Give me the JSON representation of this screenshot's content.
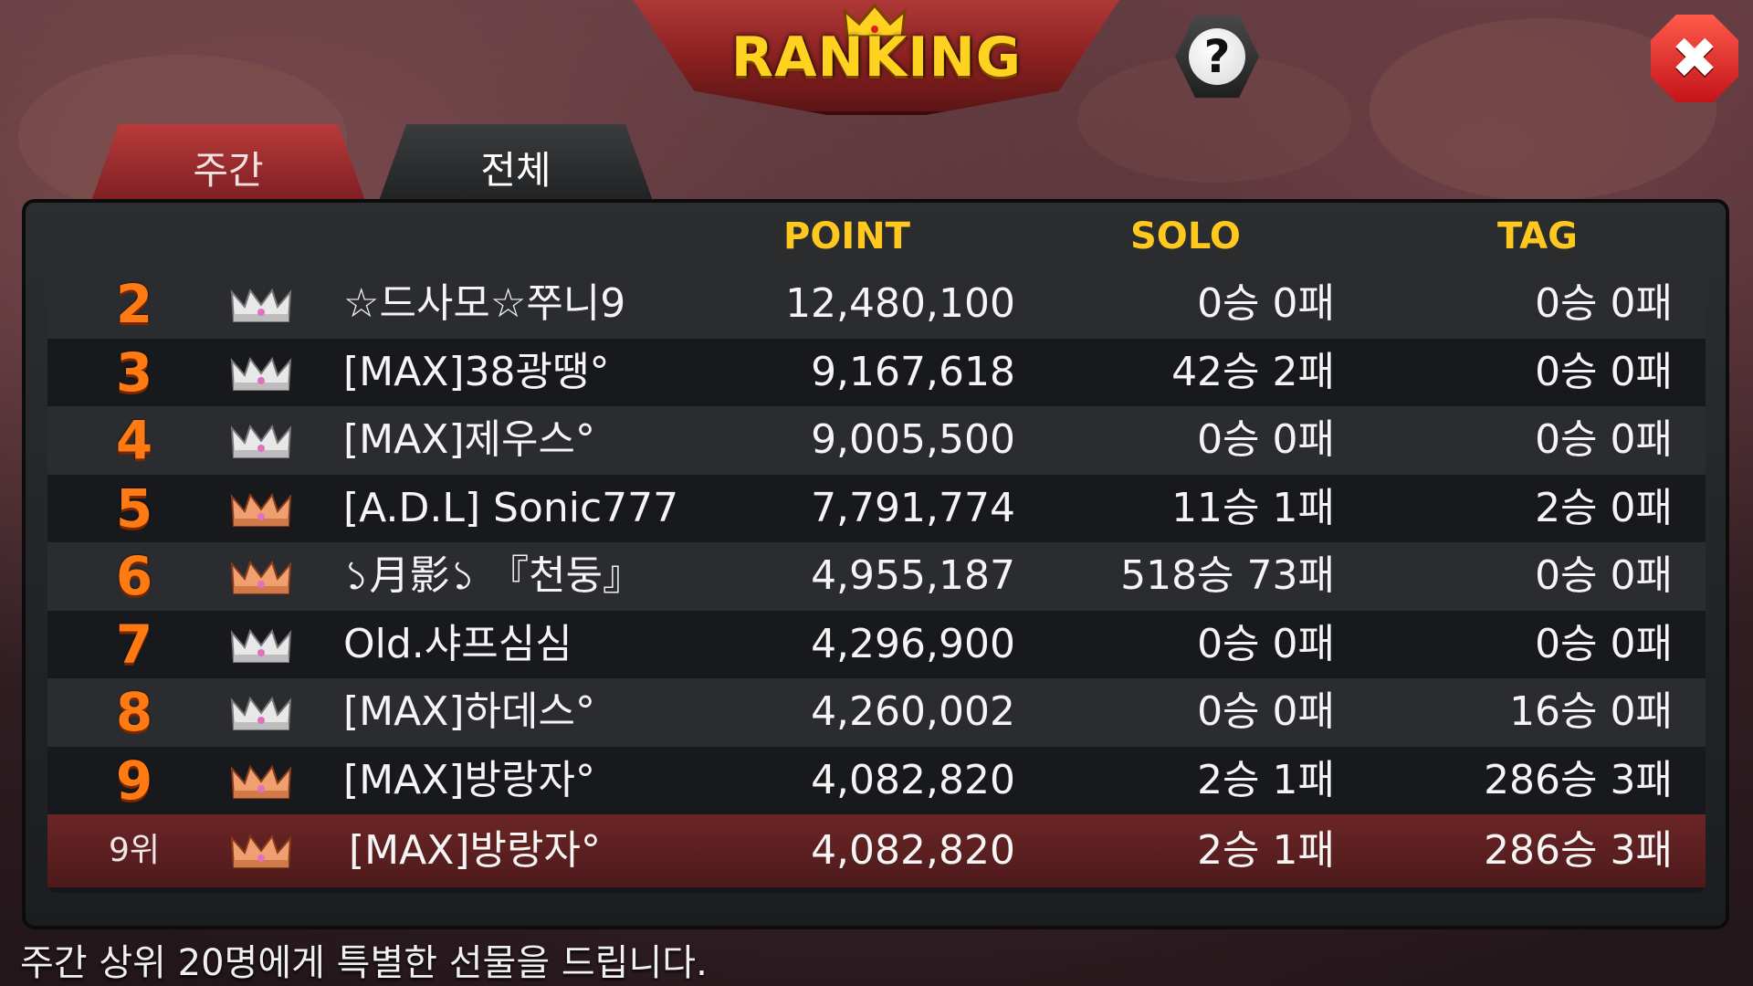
{
  "header": {
    "title": "RANKING",
    "help_label": "?",
    "close_label": "✖"
  },
  "tabs": [
    {
      "label": "주간"
    },
    {
      "label": "전체"
    }
  ],
  "columns": {
    "point": "POINT",
    "solo": "SOLO",
    "tag": "TAG"
  },
  "colors": {
    "crown_silver": "#e8e8e8",
    "crown_bronze": "#f0a070",
    "rank_orange": "#ff7a12",
    "accent_gold": "#ffc81e"
  },
  "rows": [
    {
      "rank": "2",
      "crown": "silver-crown-icon",
      "name": "☆드사모☆쭈니9",
      "point": "12,480,100",
      "solo": "0승 0패",
      "tag": "0승 0패"
    },
    {
      "rank": "3",
      "crown": "silver-crown-icon",
      "name": "[MAX]38광땡°",
      "point": "9,167,618",
      "solo": "42승 2패",
      "tag": "0승 0패"
    },
    {
      "rank": "4",
      "crown": "silver-crown-icon",
      "name": "[MAX]제우스°",
      "point": "9,005,500",
      "solo": "0승 0패",
      "tag": "0승 0패"
    },
    {
      "rank": "5",
      "crown": "bronze-crown-icon",
      "name": "[A.D.L] Sonic777",
      "point": "7,791,774",
      "solo": "11승 1패",
      "tag": "2승 0패"
    },
    {
      "rank": "6",
      "crown": "bronze-crown-icon",
      "name": "১月影১ 『천둥』",
      "point": "4,955,187",
      "solo": "518승 73패",
      "tag": "0승 0패"
    },
    {
      "rank": "7",
      "crown": "silver-crown-icon",
      "name": "Old.샤프심심",
      "point": "4,296,900",
      "solo": "0승 0패",
      "tag": "0승 0패"
    },
    {
      "rank": "8",
      "crown": "silver-crown-icon",
      "name": "[MAX]하데스°",
      "point": "4,260,002",
      "solo": "0승 0패",
      "tag": "16승 0패"
    },
    {
      "rank": "9",
      "crown": "bronze-crown-icon",
      "name": "[MAX]방랑자°",
      "point": "4,082,820",
      "solo": "2승 1패",
      "tag": "286승 3패"
    }
  ],
  "my_row": {
    "rank": "9위",
    "crown": "bronze-crown-icon",
    "name": "[MAX]방랑자°",
    "point": "4,082,820",
    "solo": "2승 1패",
    "tag": "286승 3패"
  },
  "footer": {
    "text": "주간 상위 20명에게 특별한 선물을 드립니다."
  }
}
